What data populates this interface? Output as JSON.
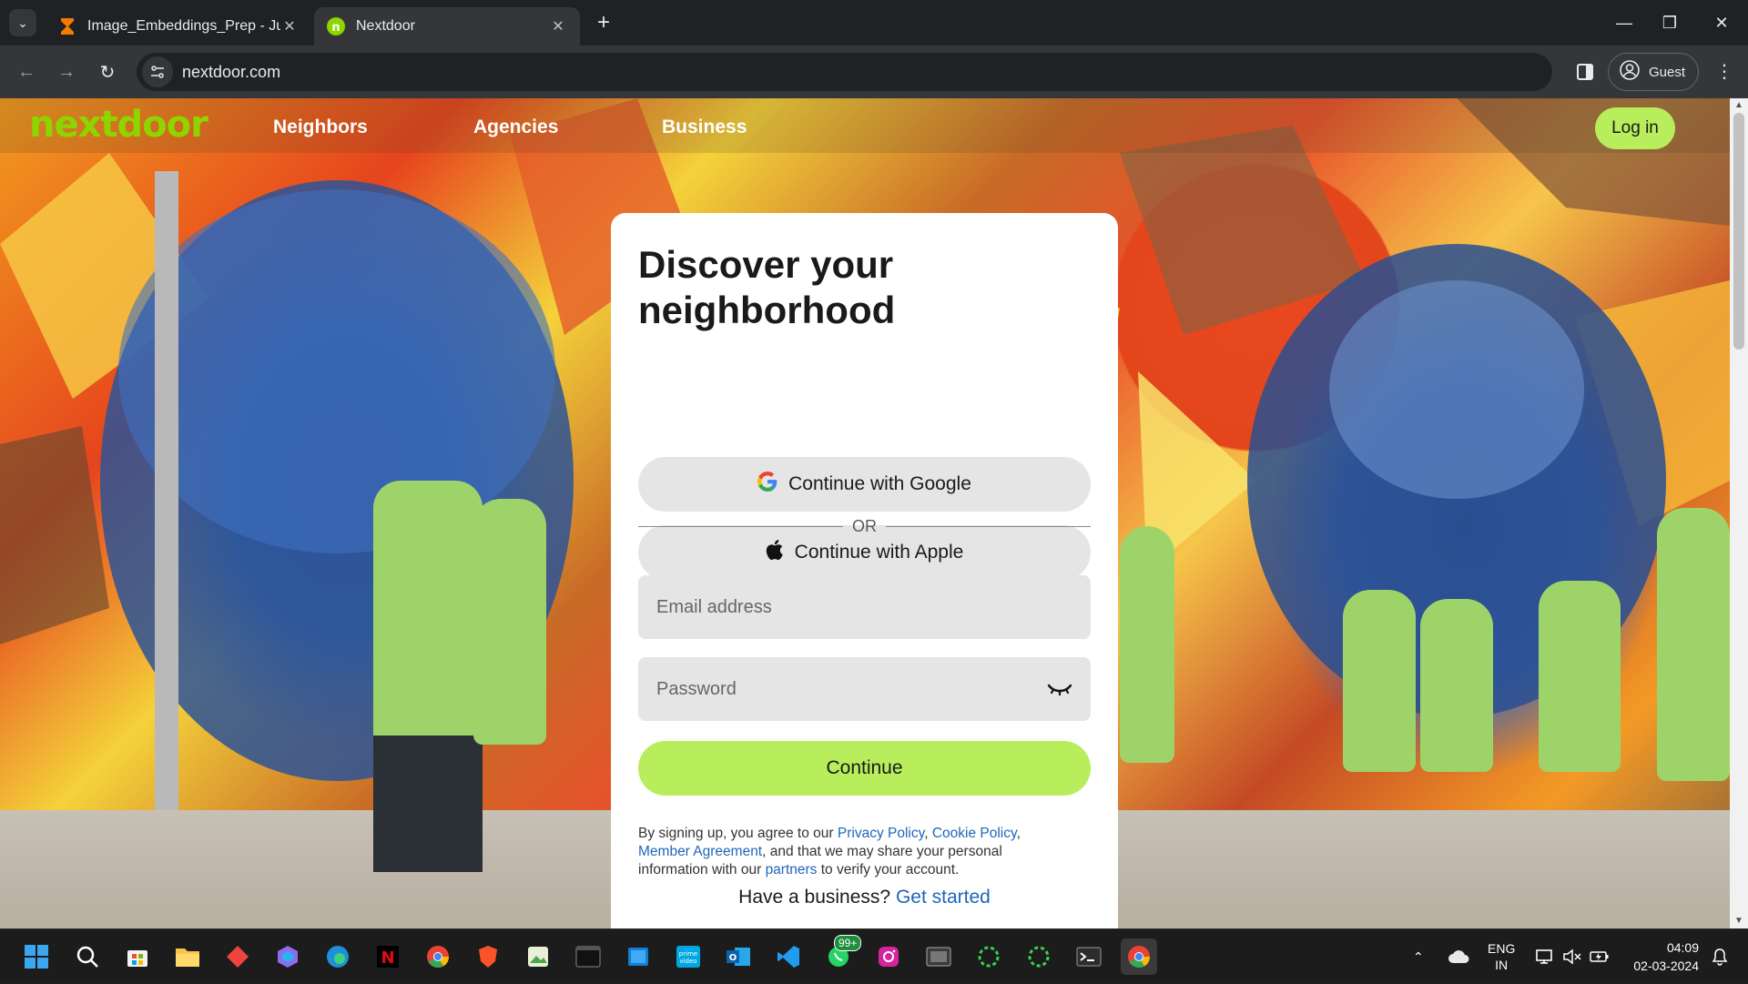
{
  "browser": {
    "tabs": [
      {
        "title": "Image_Embeddings_Prep - Jupy",
        "active": false
      },
      {
        "title": "Nextdoor",
        "active": true
      }
    ],
    "url": "nextdoor.com",
    "profile_label": "Guest"
  },
  "site": {
    "logo_text": "nextdoor",
    "nav": {
      "neighbors": "Neighbors",
      "agencies": "Agencies",
      "business": "Business"
    },
    "login_label": "Log in",
    "brand_color": "#b8ed5c"
  },
  "card": {
    "title": "Discover your neighborhood",
    "google_label": "Continue with Google",
    "apple_label": "Continue with Apple",
    "divider_text": "OR",
    "email_placeholder": "Email address",
    "password_placeholder": "Password",
    "continue_label": "Continue",
    "legal": {
      "part1": "By signing up, you agree to our ",
      "privacy": "Privacy Policy",
      "sep1": ", ",
      "cookie": "Cookie Policy",
      "sep2": ", ",
      "member": "Member Agreement",
      "part2": ", and that we may share your personal information with our ",
      "partners": "partners",
      "part3": " to verify your account."
    },
    "business_prompt": "Have a business?",
    "business_link": "Get started"
  },
  "taskbar": {
    "whatsapp_badge": "99+",
    "language_line1": "ENG",
    "language_line2": "IN",
    "time": "04:09",
    "date": "02-03-2024"
  }
}
